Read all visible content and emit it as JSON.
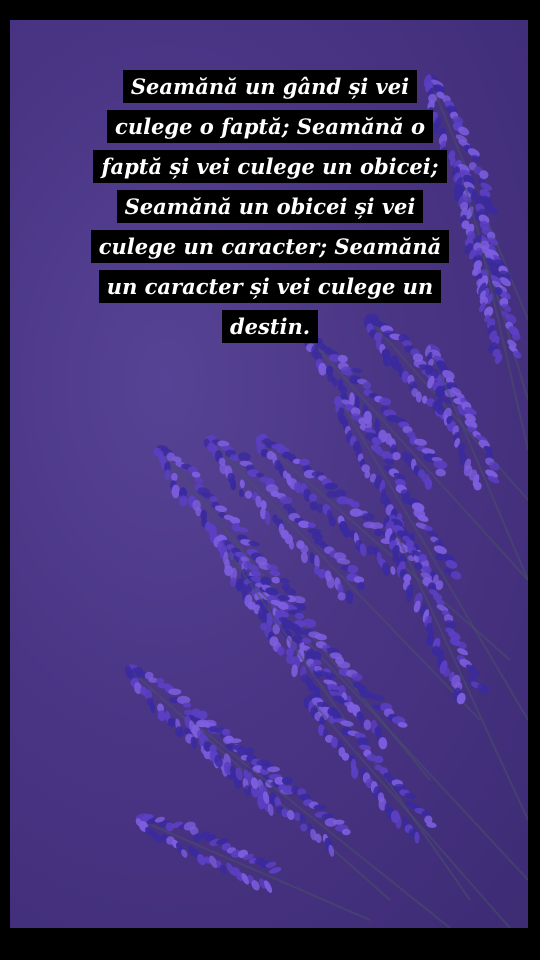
{
  "quote": {
    "lines": [
      "Seamănă un gând și vei",
      "culege o faptă; Seamănă o",
      "faptă și vei culege un obicei;",
      "Seamănă un obicei și vei",
      "culege un caracter; Seamănă",
      "un caracter și vei culege un",
      "destin."
    ]
  },
  "colors": {
    "background": "#4a3585",
    "frame": "#000000",
    "lavender_dark": "#3a2aa0",
    "lavender_mid": "#5b3fc4",
    "lavender_light": "#7d5ee0",
    "text": "#ffffff",
    "text_bg": "#000000"
  }
}
